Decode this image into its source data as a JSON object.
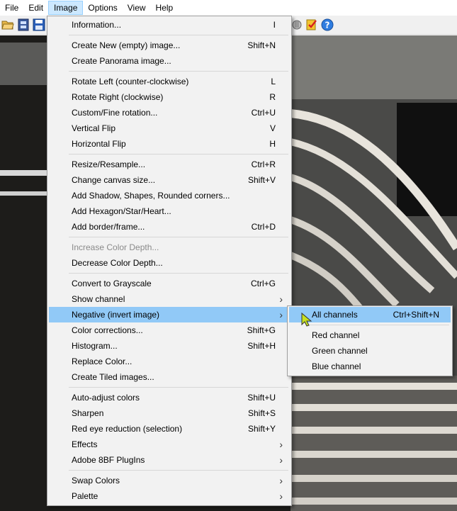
{
  "menubar": {
    "items": [
      {
        "label": "File"
      },
      {
        "label": "Edit"
      },
      {
        "label": "Image",
        "active": true
      },
      {
        "label": "Options"
      },
      {
        "label": "View"
      },
      {
        "label": "Help"
      }
    ]
  },
  "toolbar": {
    "icons": [
      "open-folder-icon",
      "filmstrip-icon",
      "save-icon",
      "scanner-icon",
      "checklist-icon",
      "help-icon"
    ]
  },
  "image_menu": {
    "items": [
      {
        "label": "Information...",
        "shortcut": "I"
      },
      {
        "label": "Create New (empty) image...",
        "shortcut": "Shift+N"
      },
      {
        "label": "Create Panorama image...",
        "shortcut": ""
      },
      {
        "label": "Rotate Left (counter-clockwise)",
        "shortcut": "L"
      },
      {
        "label": "Rotate Right (clockwise)",
        "shortcut": "R"
      },
      {
        "label": "Custom/Fine rotation...",
        "shortcut": "Ctrl+U"
      },
      {
        "label": "Vertical Flip",
        "shortcut": "V"
      },
      {
        "label": "Horizontal Flip",
        "shortcut": "H"
      },
      {
        "label": "Resize/Resample...",
        "shortcut": "Ctrl+R"
      },
      {
        "label": "Change canvas size...",
        "shortcut": "Shift+V"
      },
      {
        "label": "Add Shadow, Shapes, Rounded corners...",
        "shortcut": ""
      },
      {
        "label": "Add Hexagon/Star/Heart...",
        "shortcut": ""
      },
      {
        "label": "Add border/frame...",
        "shortcut": "Ctrl+D"
      },
      {
        "label": "Increase Color Depth...",
        "shortcut": "",
        "disabled": true
      },
      {
        "label": "Decrease Color Depth...",
        "shortcut": ""
      },
      {
        "label": "Convert to Grayscale",
        "shortcut": "Ctrl+G"
      },
      {
        "label": "Show channel",
        "shortcut": "",
        "submenu": true
      },
      {
        "label": "Negative (invert image)",
        "shortcut": "",
        "submenu": true,
        "highlighted": true
      },
      {
        "label": "Color corrections...",
        "shortcut": "Shift+G"
      },
      {
        "label": "Histogram...",
        "shortcut": "Shift+H"
      },
      {
        "label": "Replace Color...",
        "shortcut": ""
      },
      {
        "label": "Create Tiled images...",
        "shortcut": ""
      },
      {
        "label": "Auto-adjust colors",
        "shortcut": "Shift+U"
      },
      {
        "label": "Sharpen",
        "shortcut": "Shift+S"
      },
      {
        "label": "Red eye reduction (selection)",
        "shortcut": "Shift+Y"
      },
      {
        "label": "Effects",
        "shortcut": "",
        "submenu": true
      },
      {
        "label": "Adobe 8BF PlugIns",
        "shortcut": "",
        "submenu": true
      },
      {
        "label": "Swap Colors",
        "shortcut": "",
        "submenu": true
      },
      {
        "label": "Palette",
        "shortcut": "",
        "submenu": true
      }
    ]
  },
  "negative_submenu": {
    "items": [
      {
        "label": "All channels",
        "shortcut": "Ctrl+Shift+N",
        "highlighted": true
      },
      {
        "label": "Red channel",
        "shortcut": ""
      },
      {
        "label": "Green channel",
        "shortcut": ""
      },
      {
        "label": "Blue channel",
        "shortcut": ""
      }
    ]
  },
  "colors": {
    "highlight": "#91c9f7",
    "menu_bg": "#f2f2f2",
    "active_menubar": "#cce8ff"
  }
}
